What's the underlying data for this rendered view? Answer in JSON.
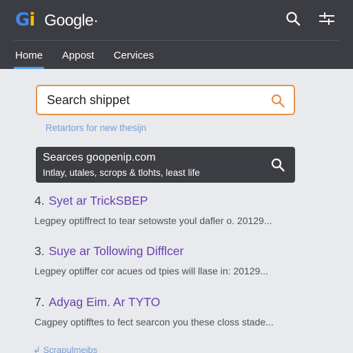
{
  "header": {
    "logo_text": "Gi",
    "brand_name": "Google·",
    "search_icon": "search-icon",
    "menu_icon": "menu-icon"
  },
  "nav": {
    "tabs": [
      {
        "label": "Home",
        "active": true
      },
      {
        "label": "Appost",
        "active": false
      },
      {
        "label": "Cervices",
        "active": false
      }
    ]
  },
  "search": {
    "value": "Search shippet",
    "icon": "search-icon"
  },
  "related_link": "Retartors for new thesijn",
  "suggestion": {
    "title": "Searces goopenip.com",
    "subtitle": "Intlay, utales, scrops & tlohts, least life",
    "icon": "search-icon"
  },
  "results": [
    {
      "number": "4.",
      "title": "Syet ar TrickSBEP",
      "snippet": "Legpey optiffrect to tear setowste youl dafler o. 20129..."
    },
    {
      "number": "3.",
      "title": "Suye ar Tollowing Difflcer",
      "snippet": "Legpey optiffer cor acues od tpies will llase in: 20129..."
    },
    {
      "number": "7.",
      "title": "Adyag Eim. Ar TYTO",
      "snippet": "Cagpey optifftes to fect searcon you these closs stade..."
    }
  ],
  "footer_link": "↲ Scrapulmeibs",
  "colors": {
    "header_bg": "#3c3d42",
    "page_bg": "#e8eaed",
    "accent_orange": "#e8914a",
    "result_title": "#6a3fb0",
    "tab_underline": "#4d9be8"
  }
}
